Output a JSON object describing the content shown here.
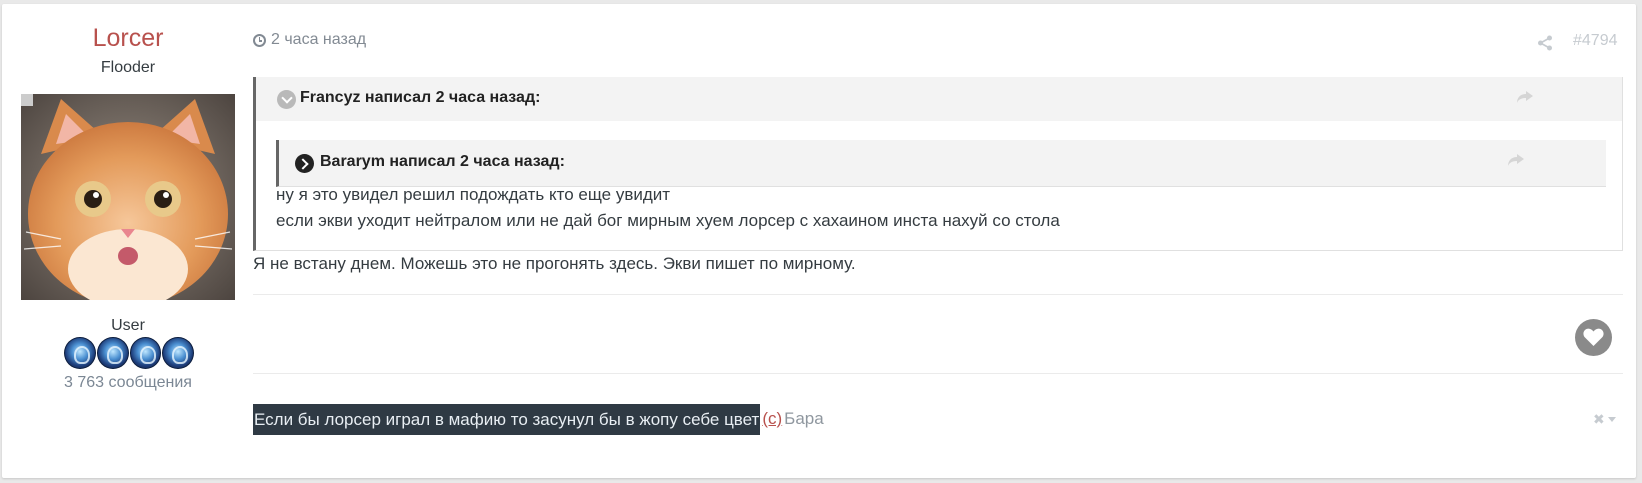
{
  "author": {
    "name": "Lorcer",
    "title": "Flooder",
    "group": "User",
    "post_count": "3 763 сообщения"
  },
  "meta": {
    "time": "2 часа назад",
    "post_number": "#4794"
  },
  "quote_outer": {
    "header": "Francyz написал 2 часа назад:",
    "lines": [
      "ну я это увидел решил подождать кто еще увидит",
      "если экви уходит нейтралом или не дай бог мирным хуем лорсер с хахаином инста нахуй со стола"
    ]
  },
  "quote_inner": {
    "header": "Bararym написал 2 часа назад:"
  },
  "post_text": "Я не встану днем. Можешь это не прогонять здесь. Экви пишет по мирному.",
  "signature": {
    "text": "Если бы лорсер играл в мафию то засунул бы в жопу себе цвет",
    "credit_mark": "(с)",
    "credit_name": "Бара"
  },
  "colors": {
    "author_name": "#b8514d",
    "signature_bg": "#2f3a44"
  },
  "icons": [
    "clock-icon",
    "share-icon",
    "reply-icon",
    "chevron-down-icon",
    "chevron-right-icon",
    "heart-icon",
    "close-icon"
  ]
}
